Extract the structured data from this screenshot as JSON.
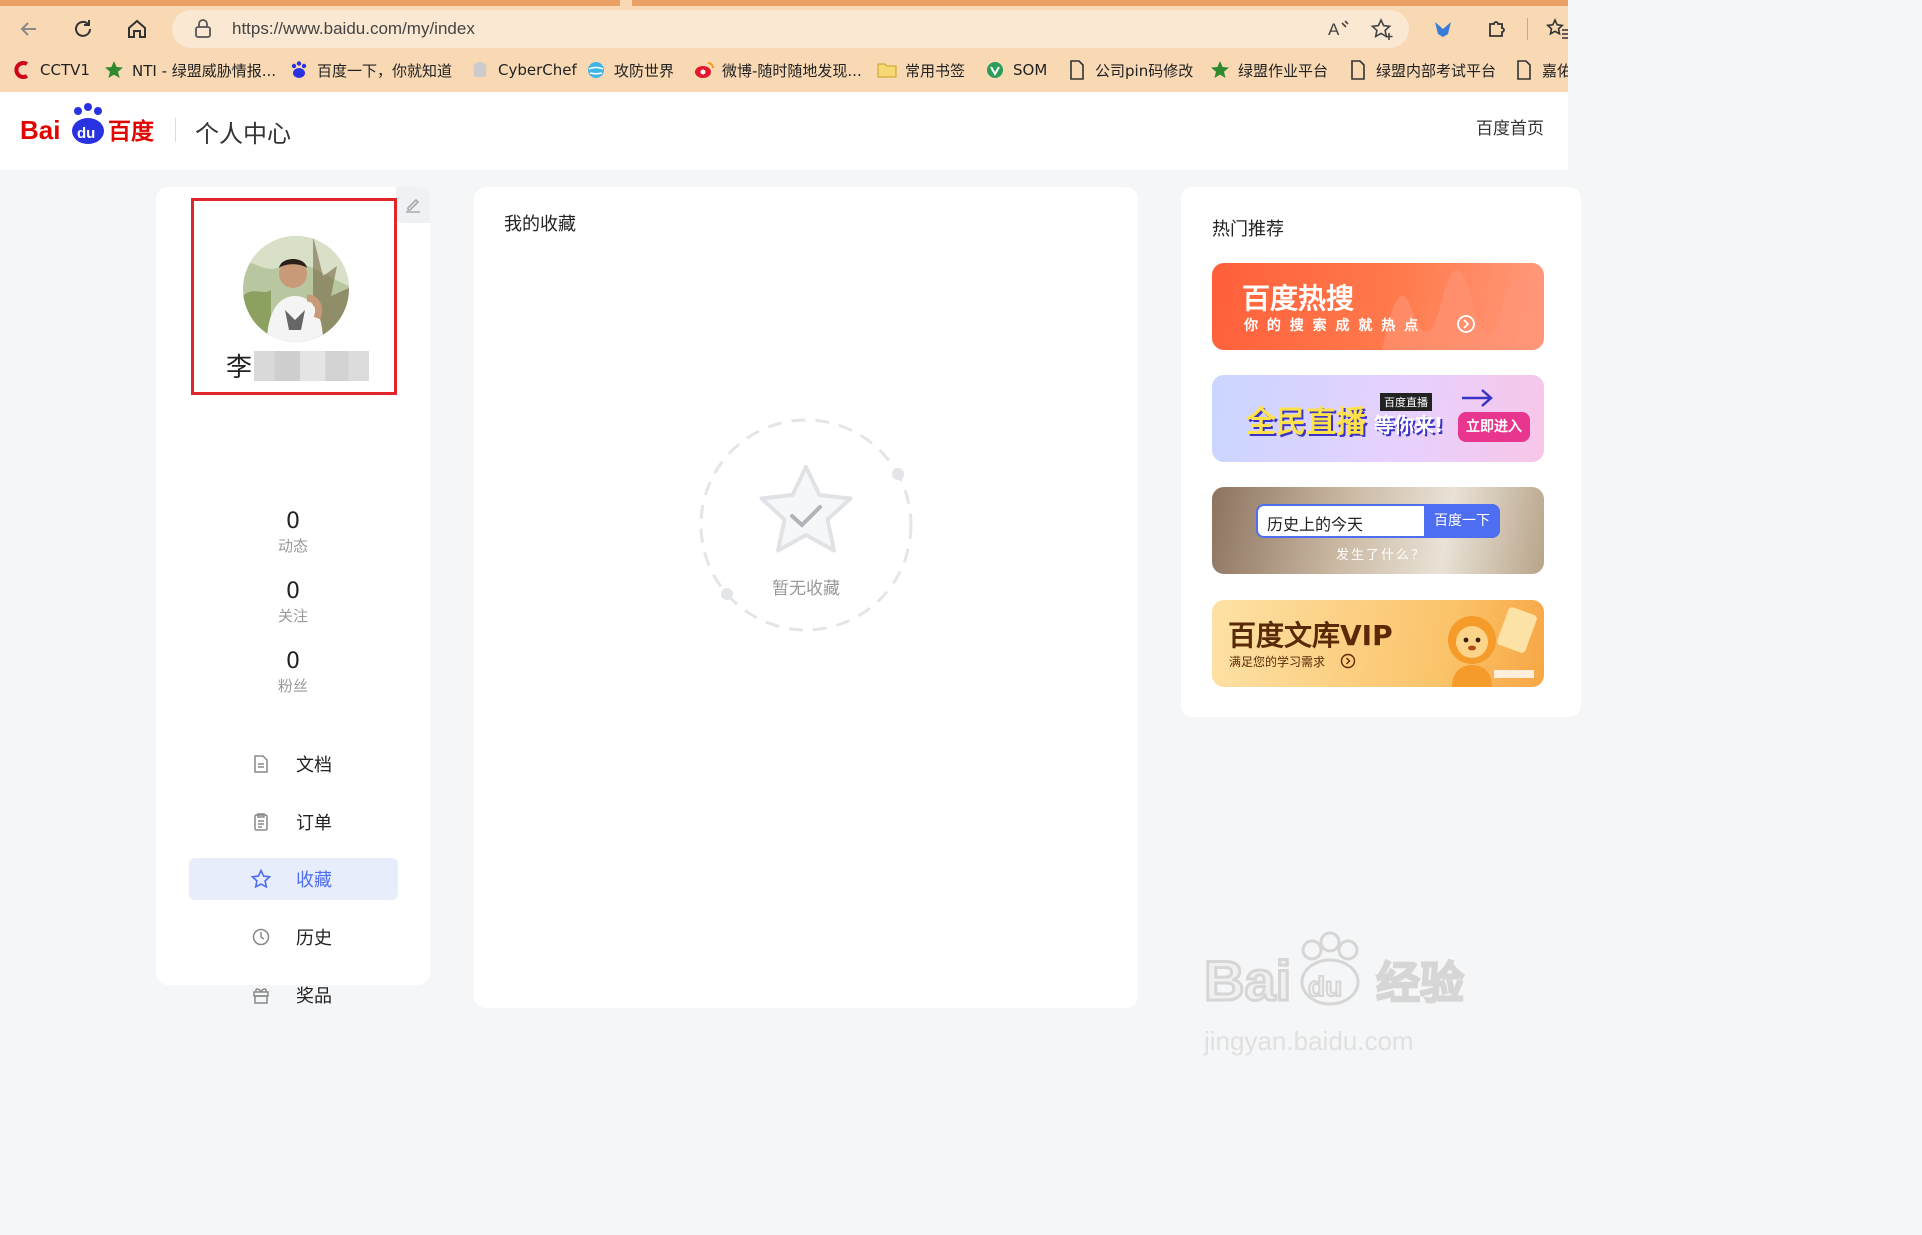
{
  "browser": {
    "url": "https://www.baidu.com/my/index",
    "bookmarks": [
      {
        "label": "CCTV1",
        "icon": "cctv-icon"
      },
      {
        "label": "NTI - 绿盟威胁情报...",
        "icon": "star-icon"
      },
      {
        "label": "百度一下，你就知道",
        "icon": "baidu-paw-icon"
      },
      {
        "label": "CyberChef",
        "icon": "chef-icon"
      },
      {
        "label": "攻防世界",
        "icon": "globe-icon"
      },
      {
        "label": "微博-随时随地发现...",
        "icon": "weibo-icon"
      },
      {
        "label": "常用书签",
        "icon": "folder-icon"
      },
      {
        "label": "SOM",
        "icon": "som-icon"
      },
      {
        "label": "公司pin码修改",
        "icon": "page-icon"
      },
      {
        "label": "绿盟作业平台",
        "icon": "star-icon"
      },
      {
        "label": "绿盟内部考试平台",
        "icon": "page-icon"
      },
      {
        "label": "嘉佑",
        "icon": "page-icon"
      }
    ]
  },
  "header": {
    "logo_text": "Bai du 百度",
    "title": "个人中心",
    "home_link": "百度首页"
  },
  "profile": {
    "name_visible": "李",
    "stats": [
      {
        "value": "0",
        "label": "动态"
      },
      {
        "value": "0",
        "label": "关注"
      },
      {
        "value": "0",
        "label": "粉丝"
      }
    ],
    "menu": [
      {
        "label": "文档",
        "icon": "document-icon",
        "active": false
      },
      {
        "label": "订单",
        "icon": "clipboard-icon",
        "active": false
      },
      {
        "label": "收藏",
        "icon": "star-outline-icon",
        "active": true
      },
      {
        "label": "历史",
        "icon": "clock-icon",
        "active": false
      },
      {
        "label": "奖品",
        "icon": "gift-icon",
        "active": false
      }
    ]
  },
  "favorites": {
    "title": "我的收藏",
    "empty_text": "暂无收藏"
  },
  "recommend": {
    "title": "热门推荐",
    "banners": [
      {
        "title": "百度热搜",
        "subtitle": "你 的 搜 索 成 就 热 点"
      },
      {
        "title": "全民直播",
        "subtitle": "等你来!",
        "tag": "百度直播",
        "cta": "立即进入"
      },
      {
        "search_text": "历史上的今天",
        "button": "百度一下",
        "subtitle": "发生了什么？"
      },
      {
        "title": "百度文库VIP",
        "subtitle": "满足您的学习需求"
      }
    ]
  },
  "watermark": {
    "text": "Bai du 经验",
    "url": "jingyan.baidu.com"
  },
  "colors": {
    "accent": "#4e6ef2",
    "highlight_box": "#e1262a",
    "baidu_red": "#e10601",
    "baidu_blue": "#2932e1"
  }
}
